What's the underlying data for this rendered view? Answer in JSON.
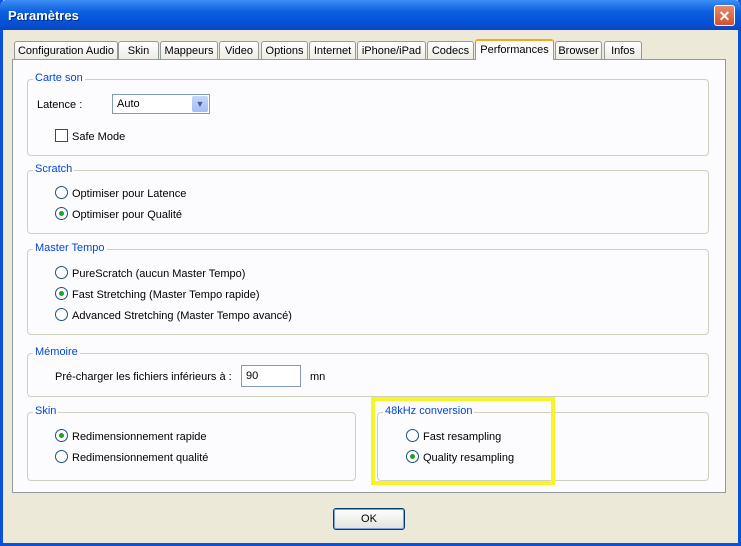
{
  "window": {
    "title": "Paramètres",
    "close_glyph": "✕"
  },
  "tabs": [
    {
      "label": "Configuration Audio"
    },
    {
      "label": "Skin"
    },
    {
      "label": "Mappeurs"
    },
    {
      "label": "Video"
    },
    {
      "label": "Options"
    },
    {
      "label": "Internet"
    },
    {
      "label": "iPhone/iPad"
    },
    {
      "label": "Codecs"
    },
    {
      "label": "Performances",
      "active": true
    },
    {
      "label": "Browser"
    },
    {
      "label": "Infos"
    }
  ],
  "carte_son": {
    "legend": "Carte son",
    "latency_label": "Latence :",
    "latency_value": "Auto",
    "safe_mode_label": "Safe Mode",
    "safe_mode_checked": false
  },
  "scratch": {
    "legend": "Scratch",
    "options": [
      {
        "label": "Optimiser pour Latence",
        "selected": false
      },
      {
        "label": "Optimiser pour Qualité",
        "selected": true
      }
    ]
  },
  "master_tempo": {
    "legend": "Master Tempo",
    "options": [
      {
        "label": "PureScratch (aucun Master Tempo)",
        "selected": false
      },
      {
        "label": "Fast Stretching (Master Tempo rapide)",
        "selected": true
      },
      {
        "label": "Advanced Stretching (Master Tempo avancé)",
        "selected": false
      }
    ]
  },
  "memoire": {
    "legend": "Mémoire",
    "preload_label": "Pré-charger les fichiers inférieurs à :",
    "preload_value": "90",
    "unit": "mn"
  },
  "skin": {
    "legend": "Skin",
    "options": [
      {
        "label": "Redimensionnement rapide",
        "selected": true
      },
      {
        "label": "Redimensionnement qualité",
        "selected": false
      }
    ]
  },
  "conversion": {
    "legend": "48kHz conversion",
    "options": [
      {
        "label": "Fast resampling",
        "selected": false
      },
      {
        "label": "Quality resampling",
        "selected": true
      }
    ]
  },
  "footer": {
    "ok_label": "OK"
  },
  "colors": {
    "highlight": "#f5f52a",
    "legend_text": "#0046d5",
    "titlebar": "#0a5fe0"
  }
}
